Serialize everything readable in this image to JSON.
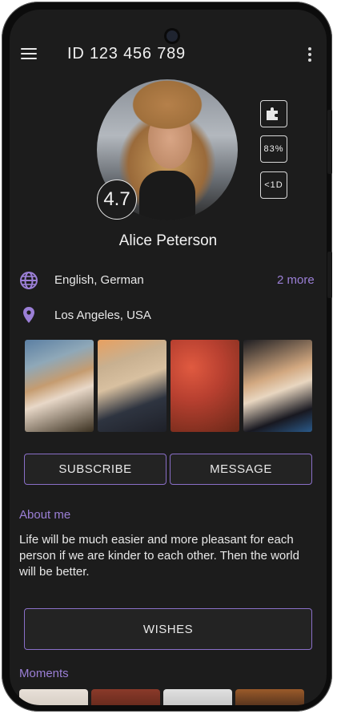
{
  "header": {
    "title": "ID 123 456 789"
  },
  "profile": {
    "rating": "4.7",
    "name": "Alice Peterson",
    "badges": {
      "match": "83%",
      "last_seen": "<1D"
    }
  },
  "info": {
    "languages": "English, German",
    "languages_more": "2 more",
    "location": "Los Angeles, USA"
  },
  "actions": {
    "subscribe": "SUBSCRIBE",
    "message": "MESSAGE",
    "wishes": "WISHES"
  },
  "about": {
    "heading": "About me",
    "text": "Life will be much easier and more pleasant for each person if we are kinder to each other. Then the world will be better."
  },
  "moments": {
    "heading": "Moments"
  },
  "colors": {
    "accent": "#9b7fd6",
    "background": "#1c1c1c",
    "button_border": "#8a6fc8"
  },
  "icons": [
    "menu-icon",
    "more-vertical-icon",
    "puzzle-icon",
    "globe-icon",
    "location-pin-icon"
  ]
}
